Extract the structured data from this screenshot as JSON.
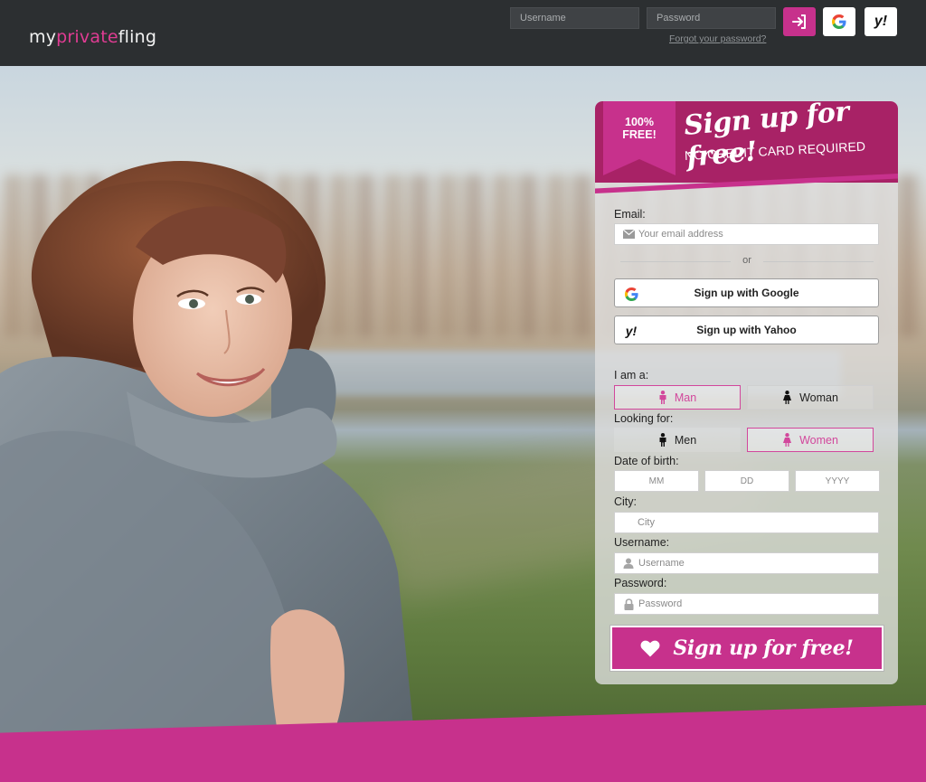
{
  "header": {
    "logo_part1": "my",
    "logo_part2": "private",
    "logo_part3": "fling",
    "username_placeholder": "Username",
    "password_placeholder": "Password",
    "forgot_link": "Forgot your password?",
    "google_letter": "G",
    "yahoo_label": "y!"
  },
  "banner": {
    "ribbon_line1": "100%",
    "ribbon_line2": "FREE!",
    "title": "Sign up for free!",
    "subtitle": "NO CREDIT CARD REQUIRED"
  },
  "form": {
    "email_label": "Email:",
    "email_placeholder": "Your email address",
    "or_text": "or",
    "google_button": "Sign up with Google",
    "yahoo_button": "Sign up with Yahoo",
    "yahoo_icon_text": "y!",
    "i_am_label": "I am a:",
    "i_am_options": [
      {
        "label": "Man",
        "selected": true
      },
      {
        "label": "Woman",
        "selected": false
      }
    ],
    "looking_for_label": "Looking for:",
    "looking_for_options": [
      {
        "label": "Men",
        "selected": false
      },
      {
        "label": "Women",
        "selected": true
      }
    ],
    "dob_label": "Date of birth:",
    "dob_mm": "MM",
    "dob_dd": "DD",
    "dob_yyyy": "YYYY",
    "city_label": "City:",
    "city_placeholder": "City",
    "username_label": "Username:",
    "username_placeholder": "Username",
    "password_label": "Password:",
    "password_placeholder": "Password",
    "submit": "Sign up for free!"
  },
  "colors": {
    "brand_pink": "#c7318c",
    "banner_dark": "#a82266",
    "header_bg": "#2c2f31",
    "active_outline": "#d2479c"
  }
}
